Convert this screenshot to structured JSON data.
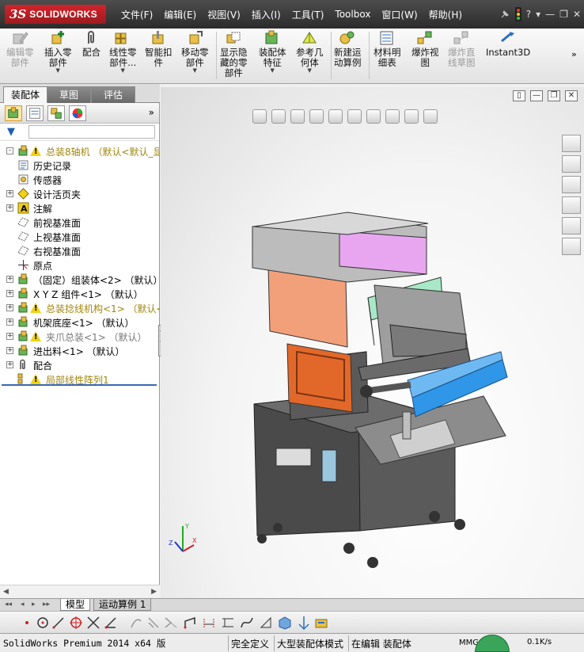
{
  "app": {
    "logo_ds": "3S",
    "logo_text": "SOLIDWORKS"
  },
  "menu": [
    "文件(F)",
    "编辑(E)",
    "视图(V)",
    "插入(I)",
    "工具(T)",
    "Toolbox",
    "窗口(W)",
    "帮助(H)"
  ],
  "title_tools": {
    "help": "?",
    "minimize": "—",
    "restore": "❐",
    "close": "✕"
  },
  "commands": [
    {
      "label": "编辑零\n部件",
      "enabled": false,
      "dropdown": false
    },
    {
      "label": "插入零\n部件",
      "enabled": true,
      "dropdown": true
    },
    {
      "label": "配合",
      "enabled": true,
      "dropdown": false
    },
    {
      "label": "线性零\n部件...",
      "enabled": true,
      "dropdown": true
    },
    {
      "label": "智能扣\n件",
      "enabled": true,
      "dropdown": false
    },
    {
      "label": "移动零\n部件",
      "enabled": true,
      "dropdown": true
    },
    {
      "label": "显示隐\n藏的零\n部件",
      "enabled": true,
      "dropdown": false
    },
    {
      "label": "装配体\n特征",
      "enabled": true,
      "dropdown": true
    },
    {
      "label": "参考几\n何体",
      "enabled": true,
      "dropdown": true
    },
    {
      "label": "新建运\n动算例",
      "enabled": true,
      "dropdown": false
    },
    {
      "label": "材料明\n细表",
      "enabled": true,
      "dropdown": false
    },
    {
      "label": "爆炸视\n图",
      "enabled": true,
      "dropdown": false
    },
    {
      "label": "爆炸直\n线草图",
      "enabled": false,
      "dropdown": false
    },
    {
      "label": "Instant3D",
      "enabled": true,
      "dropdown": false
    }
  ],
  "tabs": [
    "装配体",
    "草图",
    "评估"
  ],
  "tree": [
    {
      "text": "总装8轴机  （默认<默认_显示状",
      "expander": "-",
      "warn": true,
      "icon": "assembly-icon",
      "style": "warn"
    },
    {
      "text": "历史记录",
      "expander": "",
      "warn": false,
      "icon": "history-icon",
      "style": ""
    },
    {
      "text": "传感器",
      "expander": "",
      "warn": false,
      "icon": "sensor-icon",
      "style": ""
    },
    {
      "text": "设计活页夹",
      "expander": "+",
      "warn": false,
      "icon": "binder-icon",
      "style": ""
    },
    {
      "text": "注解",
      "expander": "+",
      "warn": false,
      "icon": "annotation-icon",
      "style": ""
    },
    {
      "text": "前视基准面",
      "expander": "",
      "warn": false,
      "icon": "plane-icon",
      "style": ""
    },
    {
      "text": "上视基准面",
      "expander": "",
      "warn": false,
      "icon": "plane-icon",
      "style": ""
    },
    {
      "text": "右视基准面",
      "expander": "",
      "warn": false,
      "icon": "plane-icon",
      "style": ""
    },
    {
      "text": "原点",
      "expander": "",
      "warn": false,
      "icon": "origin-icon",
      "style": ""
    },
    {
      "text": "（固定）组装体<2> （默认）",
      "expander": "+",
      "warn": false,
      "icon": "subassembly-icon",
      "style": ""
    },
    {
      "text": "X Y Z 组件<1> （默认）",
      "expander": "+",
      "warn": false,
      "icon": "subassembly-icon",
      "style": ""
    },
    {
      "text": "总装捻线机构<1> （默认<默",
      "expander": "+",
      "warn": true,
      "icon": "subassembly-icon",
      "style": "warn"
    },
    {
      "text": "机架底座<1> （默认）",
      "expander": "+",
      "warn": false,
      "icon": "subassembly-icon",
      "style": ""
    },
    {
      "text": "夹爪总装<1> （默认）",
      "expander": "+",
      "warn": true,
      "icon": "subassembly-icon",
      "style": "grey"
    },
    {
      "text": "进出料<1> （默认）",
      "expander": "+",
      "warn": false,
      "icon": "subassembly-icon",
      "style": ""
    },
    {
      "text": "配合",
      "expander": "+",
      "warn": false,
      "icon": "mates-icon",
      "style": ""
    },
    {
      "text": "局部线性阵列1",
      "expander": "",
      "warn": true,
      "icon": "pattern-icon",
      "style": "warn"
    }
  ],
  "bottom_tabs": [
    "模型",
    "运动算例 1"
  ],
  "status": {
    "product": "SolidWorks Premium 2014 x64 版",
    "definition": "完全定义",
    "mode": "大型装配体模式",
    "editing": "在编辑 装配体",
    "units": "MMGS",
    "network": "0.1K/s"
  },
  "colors": {
    "accent_blue": "#3568b8",
    "warning_text": "#a0860c",
    "brand_red": "#d2232a"
  }
}
